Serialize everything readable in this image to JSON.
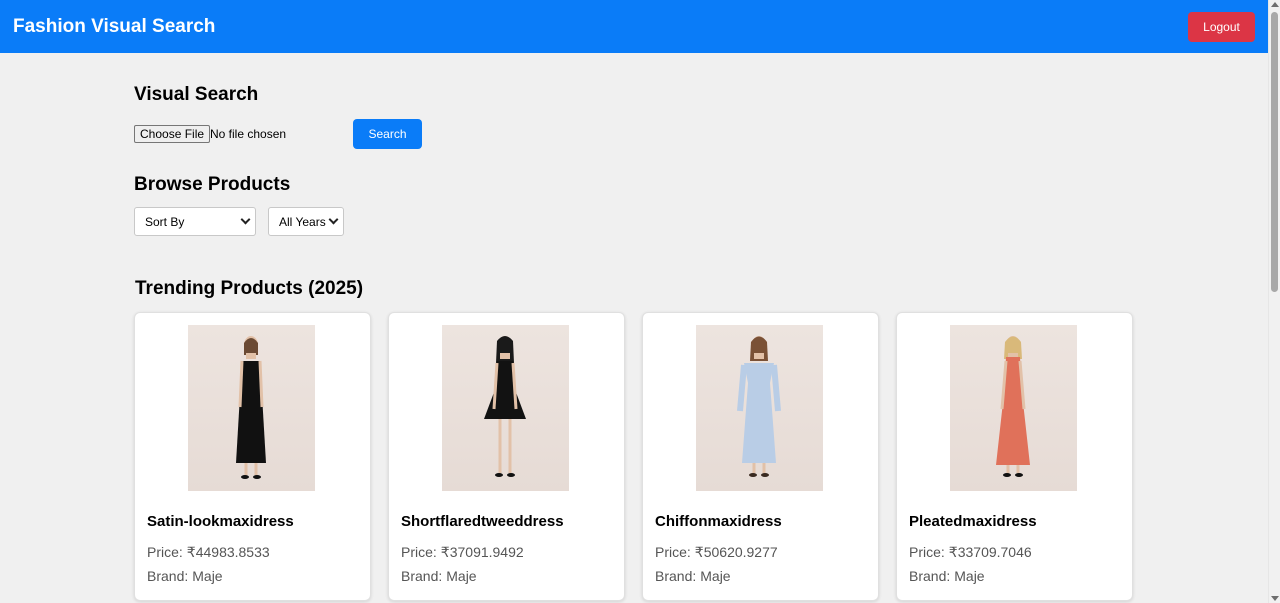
{
  "header": {
    "title": "Fashion Visual Search",
    "logout_label": "Logout"
  },
  "visual_search": {
    "heading": "Visual Search",
    "choose_file_label": "Choose File",
    "file_status": "No file chosen",
    "search_label": "Search"
  },
  "browse": {
    "heading": "Browse Products",
    "sort_selected": "Sort By",
    "year_selected": "All Years"
  },
  "trending": {
    "heading": "Trending Products (2025)",
    "price_label": "Price:",
    "brand_label": "Brand:",
    "products": [
      {
        "name": "Satin-lookmaxidress",
        "price": "₹44983.8533",
        "brand": "Maje",
        "dress_color": "#111111"
      },
      {
        "name": "Shortflaredtweeddress",
        "price": "₹37091.9492",
        "brand": "Maje",
        "dress_color": "#121212"
      },
      {
        "name": "Chiffonmaxidress",
        "price": "₹50620.9277",
        "brand": "Maje",
        "dress_color": "#b9cde6"
      },
      {
        "name": "Pleatedmaxidress",
        "price": "₹33709.7046",
        "brand": "Maje",
        "dress_color": "#e0715a"
      }
    ]
  },
  "colors": {
    "header_bg": "#0a7cf8",
    "logout_bg": "#dc3545",
    "search_bg": "#0a7cf8",
    "page_bg": "#f0f0f0"
  },
  "icons": {
    "select_arrow": "chevron-down-icon"
  }
}
